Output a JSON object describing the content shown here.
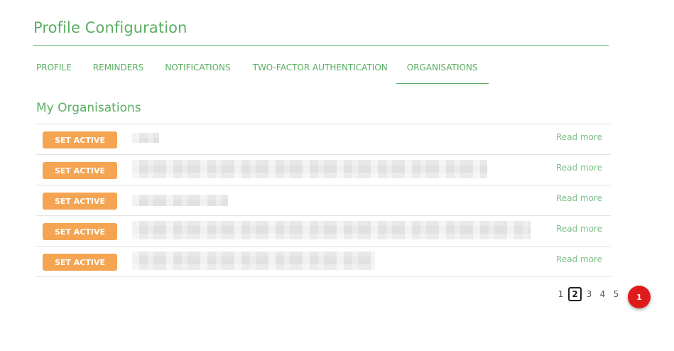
{
  "page_title": "Profile Configuration",
  "tabs": [
    {
      "label": "PROFILE",
      "active": false
    },
    {
      "label": "REMINDERS",
      "active": false
    },
    {
      "label": "NOTIFICATIONS",
      "active": false
    },
    {
      "label": "TWO-FACTOR AUTHENTICATION",
      "active": false
    },
    {
      "label": "ORGANISATIONS",
      "active": true
    }
  ],
  "section_title": "My Organisations",
  "organisations": [
    {
      "button_label": "SET ACTIVE",
      "name": "",
      "link_label": "Read more"
    },
    {
      "button_label": "SET ACTIVE",
      "name": "",
      "link_label": "Read more"
    },
    {
      "button_label": "SET ACTIVE",
      "name": "",
      "link_label": "Read more"
    },
    {
      "button_label": "SET ACTIVE",
      "name": "",
      "link_label": "Read more"
    },
    {
      "button_label": "SET ACTIVE",
      "name": "",
      "link_label": "Read more"
    }
  ],
  "pagination": {
    "pages": [
      "1",
      "2",
      "3",
      "4",
      "5"
    ],
    "current": "2"
  },
  "notification_badge": {
    "count": "1"
  },
  "colors": {
    "accent": "#5aae62",
    "button": "#f5a452",
    "link": "#7dc088",
    "badge": "#e01b1b"
  }
}
